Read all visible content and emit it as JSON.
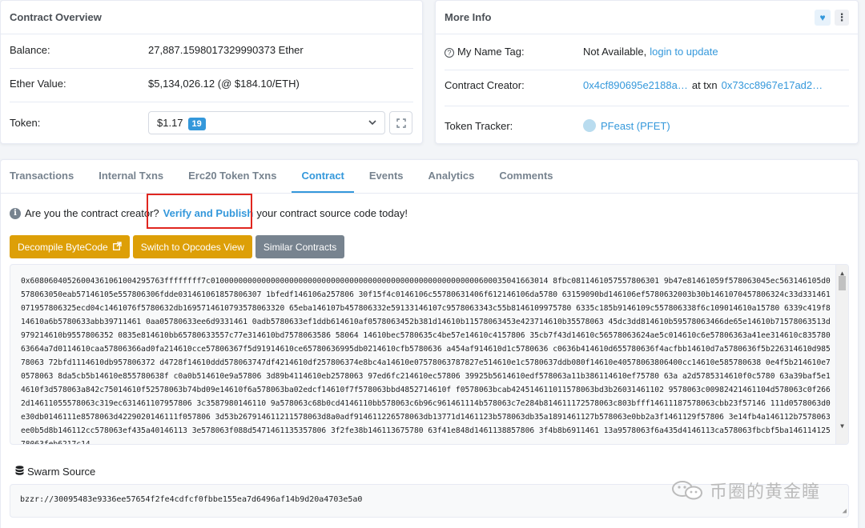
{
  "overview": {
    "title": "Contract Overview",
    "balance_label": "Balance:",
    "balance_value": "27,887.1598017329990373 Ether",
    "ether_value_label": "Ether Value:",
    "ether_value": "$5,134,026.12 (@ $184.10/ETH)",
    "token_label": "Token:",
    "token_value": "$1.17",
    "token_count": "19"
  },
  "more_info": {
    "title": "More Info",
    "name_tag_label": "My Name Tag:",
    "name_tag_value": "Not Available,",
    "name_tag_link": "login to update",
    "creator_label": "Contract Creator:",
    "creator_address": "0x4cf890695e2188a…",
    "creator_at_txn": "at txn",
    "creator_txn": "0x73cc8967e17ad2…",
    "tracker_label": "Token Tracker:",
    "tracker_value": "PFeast (PFET)"
  },
  "tabs": [
    {
      "label": "Transactions",
      "active": false
    },
    {
      "label": "Internal Txns",
      "active": false
    },
    {
      "label": "Erc20 Token Txns",
      "active": false
    },
    {
      "label": "Contract",
      "active": true
    },
    {
      "label": "Events",
      "active": false
    },
    {
      "label": "Analytics",
      "active": false
    },
    {
      "label": "Comments",
      "active": false
    }
  ],
  "notice": {
    "prefix": "Are you the contract creator?",
    "link": "Verify and Publish",
    "suffix": "your contract source code today!"
  },
  "buttons": {
    "decompile": "Decompile ByteCode",
    "opcodes": "Switch to Opcodes View",
    "similar": "Similar Contracts"
  },
  "bytecode": "0x60806040526004361061004295763ffffffff7c0100000000000000000000000000000000000000000000000000000000600035041663014 8fbc0811461057557806301 9b47e81461059f578063045ec563146105d0578063050eab57146105e557806306fdde031461061857806307 1bfedf146106a257806 30f15f4c0146106c55780631406f612146106da5780 63159090bd146106ef5780632003b30b1461070457806324c33d331461071957806325ecd04c1461076f5780632db1695714610793578063320 65eba146107b457806332e59133146107c9578063343c55b8146109975780 6335c185b9146109c557806338f6c109014610a15780 6339c419f814610a6b5780633abb39711461 0aa05780633ee6d9331461 0adb5780633ef1ddb614610af0578063452b381d14610b11578063453e423714610b35578063 45dc3dd814610b59578063466de65e14610b71578063513d979214610b9557806352 0835e814610bb65780633557c77e314610bd7578063586 58064 14610bec5780635c4be57e14610c4157806 35cb7f43d14610c56578063624ae5c014610c6e57806363a41ee314610c83578063664a7d0114610caa57806366ad0fa214610cce57806367f5d91914610ce65780636995db0214610cfb5780636 a454af914610d1c5780636 c0636b414610d655780636f4acfbb14610d7a5780636f5b226314610d98578063 72bfd1114610db957806372 d4728f14610ddd578063747df4214610df257806374e8bc4a14610e07578063787827e514610e1c5780637ddb080f14610e40578063806400cc14610e585780638 0e4f5b214610e70578063 8da5cb5b14610e855780638f c0a0b514610e9a57806 3d89b4114610eb2578063 97ed6fc214610ec57806 39925b5614610edf578063a11b386114610ef75780 63a a2d5785314610f0c5780 63a39baf5e14610f3d578063a842c75014610f52578063b74bd09e14610f6a578063ba02edcf14610f7f578063bbd4852714610f f0578063bcab424514611011578063bd3b26031461102 9578063c00982421461104d578063c0f2662d14611055578063c319ec631461107957806 3c3587980146110 9a578063c68b0cd4146110bb578063c6b96c961461114b578063c7e284b814611172578063c803bfff14611187578063cbb23f57146 111d0578063d0e30db0146111e8578063d4229020146111f057806 3d53b267914611211578063d8a0adf914611226578063db13771d1461123b578063db35a1891461127b578063e0bb2a3f1461129f57806 3e14fb4a146112b7578063ee0b5d8b146112cc578063ef435a40146113 3e578063f088d5471461135357806 3f2fe38b146113675780 63f41e848d1461138857806 3f4b8b6911461 13a9578063f6a435d4146113ca578063fbcbf5ba146114125 78063feb6217c14",
  "swarm": {
    "label": "Swarm Source",
    "value": "bzzr://30095483e9336ee57654f2fe4cdfcf0fbbe155ea7d6496af14b9d20a4703e5a0"
  },
  "watermark": "币圈的黄金瞳",
  "colors": {
    "link": "#3498db",
    "warning_button": "#dd9f07",
    "secondary_button": "#77838f",
    "highlight_box": "#e0261f"
  },
  "icons": {
    "info": "question-circle-icon",
    "heart": "heart-icon",
    "menu": "vertical-dots-icon",
    "expand": "expand-icon",
    "external": "external-link-icon",
    "database": "database-icon"
  }
}
